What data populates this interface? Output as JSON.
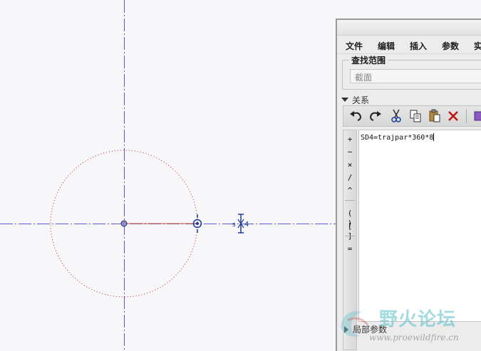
{
  "dialog": {
    "menu": [
      "文件",
      "编辑",
      "插入",
      "参数",
      "实"
    ],
    "scope": {
      "legend": "查找范围",
      "value": "截面"
    },
    "relations_label": "关系",
    "toolbar_icons": [
      "undo-icon",
      "redo-icon",
      "cut-icon",
      "copy-icon",
      "paste-icon",
      "delete-icon"
    ],
    "operators": [
      "+",
      "−",
      "×",
      "/",
      "^",
      "( )",
      "[ ]",
      "="
    ],
    "relation_text": "SD4=trajpar*360*8",
    "local_params_label": "局部参数"
  },
  "sketch": {
    "dimension_label": "4",
    "dimension_prefix": "s"
  },
  "watermark": {
    "title": "野火论坛",
    "url": "www.proewildfire.cn"
  },
  "colors": {
    "construction_line": "#5a5ad2",
    "circle": "#c02040",
    "canvas_bg": "#f7f7f9",
    "dialog_bg": "#ececec",
    "accent_blue": "#1a3a9a"
  }
}
